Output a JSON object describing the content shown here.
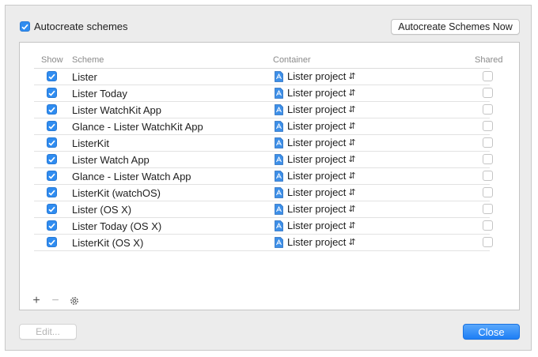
{
  "autocreate": {
    "label": "Autocreate schemes",
    "checked": true
  },
  "autocreate_now_button": "Autocreate Schemes Now",
  "table": {
    "headers": {
      "show": "Show",
      "scheme": "Scheme",
      "container": "Container",
      "shared": "Shared"
    },
    "rows": [
      {
        "show": true,
        "scheme": "Lister",
        "container": "Lister project",
        "shared": false
      },
      {
        "show": true,
        "scheme": "Lister Today",
        "container": "Lister project",
        "shared": false
      },
      {
        "show": true,
        "scheme": "Lister WatchKit App",
        "container": "Lister project",
        "shared": false
      },
      {
        "show": true,
        "scheme": "Glance - Lister WatchKit App",
        "container": "Lister project",
        "shared": false
      },
      {
        "show": true,
        "scheme": "ListerKit",
        "container": "Lister project",
        "shared": false
      },
      {
        "show": true,
        "scheme": "Lister Watch App",
        "container": "Lister project",
        "shared": false
      },
      {
        "show": true,
        "scheme": "Glance - Lister Watch App",
        "container": "Lister project",
        "shared": false
      },
      {
        "show": true,
        "scheme": "ListerKit (watchOS)",
        "container": "Lister project",
        "shared": false
      },
      {
        "show": true,
        "scheme": "Lister (OS X)",
        "container": "Lister project",
        "shared": false
      },
      {
        "show": true,
        "scheme": "Lister Today (OS X)",
        "container": "Lister project",
        "shared": false
      },
      {
        "show": true,
        "scheme": "ListerKit (OS X)",
        "container": "Lister project",
        "shared": false
      }
    ]
  },
  "tools": {
    "add": "+",
    "remove": "−",
    "settings_icon": "gear-icon"
  },
  "buttons": {
    "edit": "Edit...",
    "close": "Close"
  },
  "colors": {
    "accent": "#2f8cf0",
    "close_button": "#1d7ef5"
  }
}
